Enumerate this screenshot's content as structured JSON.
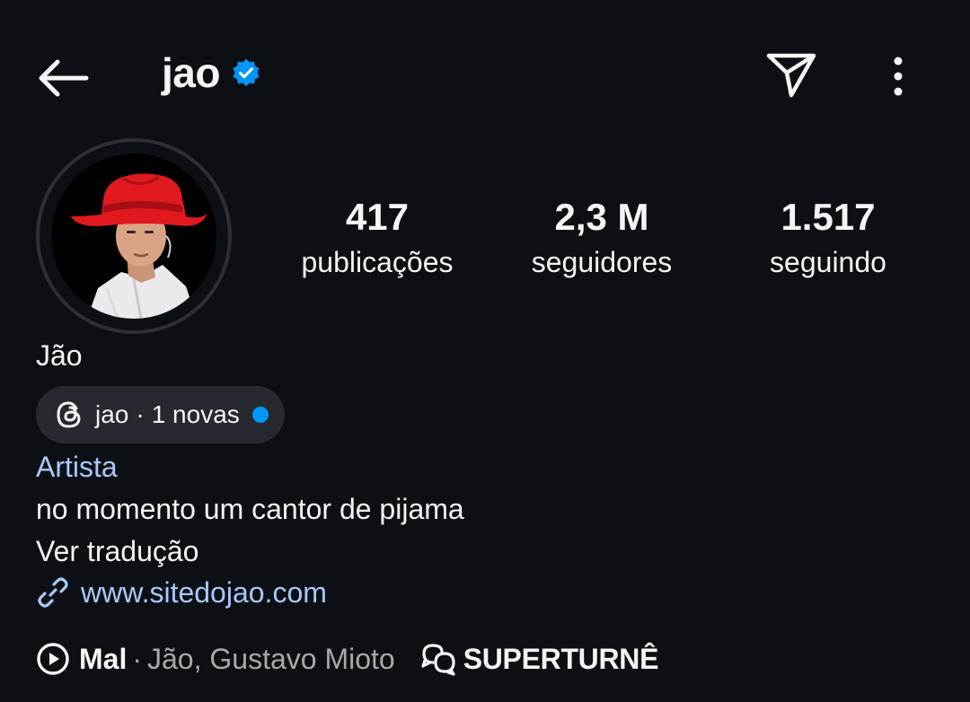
{
  "header": {
    "title": "jao",
    "back_icon": "arrow-left-icon",
    "verified_icon": "verified-badge-icon",
    "send_icon": "paper-plane-icon",
    "more_icon": "more-vertical-icon"
  },
  "profile": {
    "avatar_icon": "profile-photo"
  },
  "stats": {
    "posts": {
      "value": "417",
      "label": "publicações"
    },
    "followers": {
      "value": "2,3 M",
      "label": "seguidores"
    },
    "following": {
      "value": "1.517",
      "label": "seguindo"
    }
  },
  "bio": {
    "display_name": "Jão",
    "threads": {
      "icon": "threads-icon",
      "username": "jao",
      "separator": "·",
      "new_label": "1 novas"
    },
    "category": "Artista",
    "text": "no momento um cantor de pijama",
    "translate_label": "Ver tradução",
    "link_icon": "link-icon",
    "link": "www.sitedojao.com"
  },
  "music": {
    "play_icon": "play-circle-icon",
    "song": "Mal",
    "separator": "·",
    "artists": "Jão, Gustavo Mioto",
    "tour_icon": "chat-bubbles-icon",
    "tour_label": "SUPERTURNÊ"
  },
  "colors": {
    "background": "#0c1014",
    "text": "#f5f5f5",
    "link": "#a8c7fa",
    "muted": "#a8a8a8",
    "verified_blue": "#0095f6",
    "pill_bg": "#262a30"
  }
}
